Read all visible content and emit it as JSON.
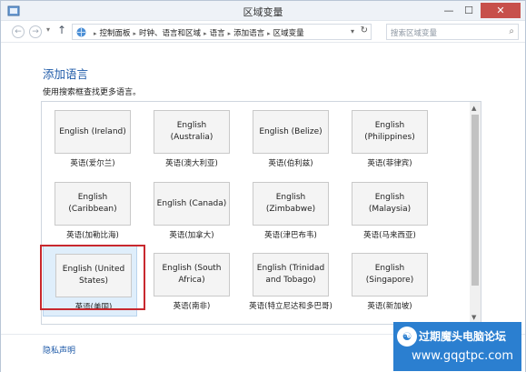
{
  "window": {
    "title": "区域变量",
    "minimize": "—",
    "maximize": "☐",
    "close": "✕"
  },
  "nav": {
    "back": "←",
    "forward": "→",
    "up": "↑",
    "breadcrumbs": [
      "控制面板",
      "时钟、语言和区域",
      "语言",
      "添加语言",
      "区域变量"
    ],
    "search_placeholder": "搜索区域变量"
  },
  "main": {
    "heading": "添加语言",
    "subtitle": "使用搜索框查找更多语言。"
  },
  "tiles": [
    {
      "label": "English (Ireland)",
      "caption": "英语(爱尔兰)"
    },
    {
      "label": "English (Australia)",
      "caption": "英语(澳大利亚)"
    },
    {
      "label": "English (Belize)",
      "caption": "英语(伯利兹)"
    },
    {
      "label": "English (Philippines)",
      "caption": "英语(菲律宾)"
    },
    {
      "label": "English (Caribbean)",
      "caption": "英语(加勒比海)"
    },
    {
      "label": "English (Canada)",
      "caption": "英语(加拿大)"
    },
    {
      "label": "English (Zimbabwe)",
      "caption": "英语(津巴布韦)"
    },
    {
      "label": "English (Malaysia)",
      "caption": "英语(马来西亚)"
    },
    {
      "label": "English (United States)",
      "caption": "英语(美国)",
      "selected": true
    },
    {
      "label": "English (South Africa)",
      "caption": "英语(南非)"
    },
    {
      "label": "English (Trinidad and Tobago)",
      "caption": "英语(特立尼达和多巴哥)"
    },
    {
      "label": "English (Singapore)",
      "caption": "英语(新加坡)"
    }
  ],
  "footer": {
    "privacy_link": "隐私声明"
  },
  "watermark": {
    "text": "过期魔头电脑论坛",
    "url": "www.gqgtpc.com"
  },
  "colors": {
    "accent": "#1e5aa8",
    "highlight": "#c8282e",
    "selected_bg": "#dfeefb"
  }
}
